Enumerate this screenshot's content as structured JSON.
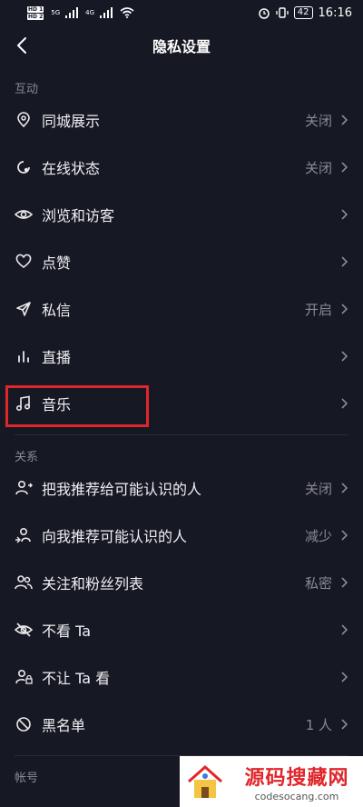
{
  "status_bar": {
    "hd1": "HD 1",
    "hd2": "HD 2",
    "net1": "5G",
    "net2": "4G",
    "battery": "42",
    "time": "16:16"
  },
  "header": {
    "title": "隐私设置"
  },
  "sections": {
    "interaction": {
      "title": "互动",
      "items": [
        {
          "label": "同城展示",
          "value": "关闭",
          "icon": "location-pin-icon"
        },
        {
          "label": "在线状态",
          "value": "关闭",
          "icon": "online-status-icon"
        },
        {
          "label": "浏览和访客",
          "value": "",
          "icon": "eye-icon"
        },
        {
          "label": "点赞",
          "value": "",
          "icon": "heart-icon"
        },
        {
          "label": "私信",
          "value": "开启",
          "icon": "send-icon"
        },
        {
          "label": "直播",
          "value": "",
          "icon": "live-bars-icon"
        },
        {
          "label": "音乐",
          "value": "",
          "icon": "music-note-icon"
        }
      ]
    },
    "relations": {
      "title": "关系",
      "items": [
        {
          "label": "把我推荐给可能认识的人",
          "value": "关闭",
          "icon": "user-share-icon"
        },
        {
          "label": "向我推荐可能认识的人",
          "value": "减少",
          "icon": "user-recommend-icon"
        },
        {
          "label": "关注和粉丝列表",
          "value": "私密",
          "icon": "users-icon"
        },
        {
          "label": "不看 Ta",
          "value": "",
          "icon": "eye-off-icon"
        },
        {
          "label": "不让 Ta 看",
          "value": "",
          "icon": "user-lock-icon"
        },
        {
          "label": "黑名单",
          "value": "1 人",
          "icon": "block-icon"
        }
      ]
    },
    "account": {
      "title": "帐号"
    }
  },
  "watermark": {
    "cn": "源码搜藏网",
    "en": "codesocang.com"
  },
  "colors": {
    "background": "#161823",
    "highlight": "#e0262b",
    "muted": "#8a8b91"
  }
}
